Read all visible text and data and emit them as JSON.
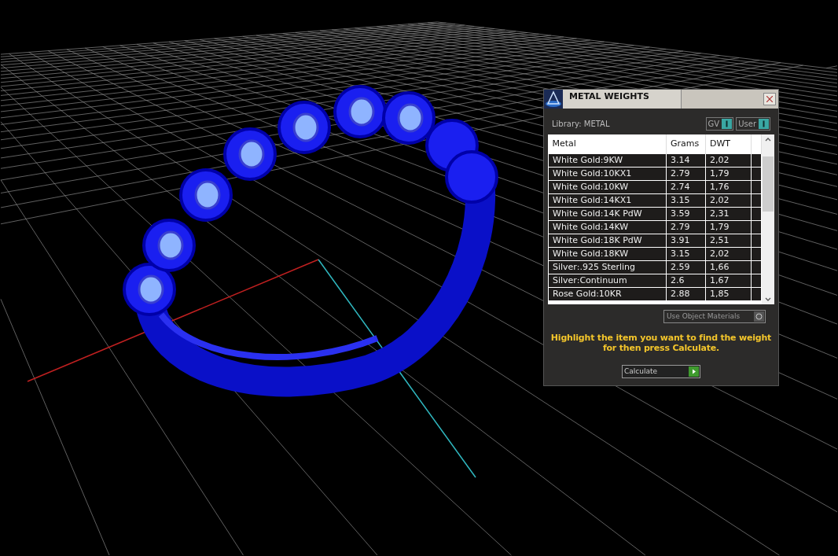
{
  "panel": {
    "title": "METAL WEIGHTS",
    "library_label": "Library: METAL",
    "toggles": [
      {
        "label": "GV",
        "on": true
      },
      {
        "label": "User",
        "on": true
      }
    ],
    "table": {
      "columns": [
        "Metal",
        "Grams",
        "DWT"
      ],
      "rows": [
        [
          "White Gold:9KW",
          "3.14",
          "2,02"
        ],
        [
          "White Gold:10KX1",
          "2.79",
          "1,79"
        ],
        [
          "White Gold:10KW",
          "2.74",
          "1,76"
        ],
        [
          "White Gold:14KX1",
          "3.15",
          "2,02"
        ],
        [
          "White Gold:14K PdW",
          "3.59",
          "2,31"
        ],
        [
          "White Gold:14KW",
          "2.79",
          "1,79"
        ],
        [
          "White Gold:18K PdW",
          "3.91",
          "2,51"
        ],
        [
          "White Gold:18KW",
          "3.15",
          "2,02"
        ],
        [
          "Silver:.925 Sterling",
          "2.59",
          "1,66"
        ],
        [
          "Silver:Continuum",
          "2.6",
          "1,67"
        ],
        [
          "Rose Gold:10KR",
          "2.88",
          "1,85"
        ]
      ]
    },
    "use_object_materials": {
      "label": "Use Object Materials",
      "on": false
    },
    "hint": "Highlight the item you want to find the weight for then press Calculate.",
    "calculate_button": "Calculate"
  }
}
